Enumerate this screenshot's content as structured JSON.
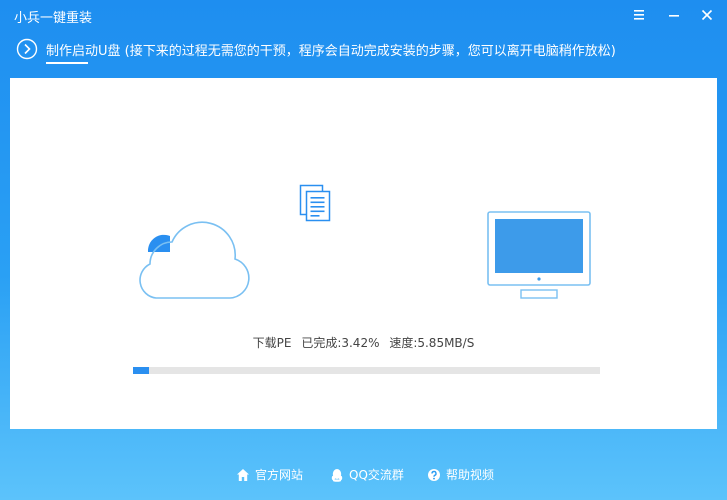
{
  "window": {
    "title": "小兵一键重装",
    "icons": [
      "menu-icon",
      "minimize-icon",
      "close-icon"
    ]
  },
  "step": {
    "text": "制作启动U盘 (接下来的过程无需您的干预，程序会自动完成安装的步骤，您可以离开电脑稍作放松)",
    "icon": "chevron-right-circle-icon"
  },
  "transfer": {
    "icons": [
      "cloud-icon",
      "document-icon",
      "monitor-icon"
    ]
  },
  "status": {
    "task": "下载PE",
    "completed": "已完成:3.42%",
    "speed": "速度:5.85MB/S"
  },
  "progress": {
    "fraction": 0.0342,
    "color": "#2a8ff0"
  },
  "footer": {
    "links": [
      {
        "label": "官方网站",
        "icon": "home-icon"
      },
      {
        "label": "QQ交流群",
        "icon": "qq-icon"
      },
      {
        "label": "帮助视频",
        "icon": "help-icon"
      }
    ]
  },
  "colors": {
    "accent": "#1e8ef0",
    "panel": "#ffffff"
  }
}
